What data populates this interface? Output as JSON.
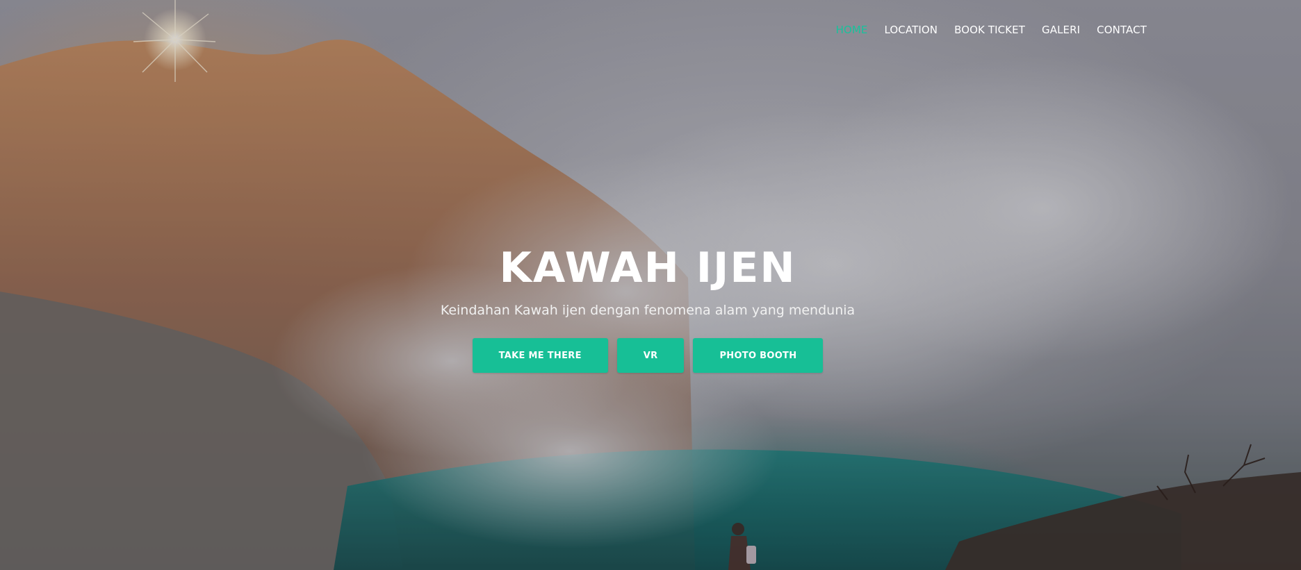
{
  "nav": {
    "items": [
      {
        "label": "HOME",
        "active": true
      },
      {
        "label": "LOCATION",
        "active": false
      },
      {
        "label": "BOOK TICKET",
        "active": false
      },
      {
        "label": "GALERI",
        "active": false
      },
      {
        "label": "CONTACT",
        "active": false
      }
    ]
  },
  "hero": {
    "title": "KAWAH IJEN",
    "subtitle": "Keindahan Kawah ijen dengan fenomena alam yang mendunia",
    "buttons": {
      "take_me_there": "TAKE ME THERE",
      "vr": "VR",
      "photo_booth": "PHOTO BOOTH"
    },
    "background_image": "volcano-crater-sunrise-photo"
  },
  "colors": {
    "accent": "#17bf96",
    "nav_active": "#18c29c",
    "text": "#ffffff"
  }
}
